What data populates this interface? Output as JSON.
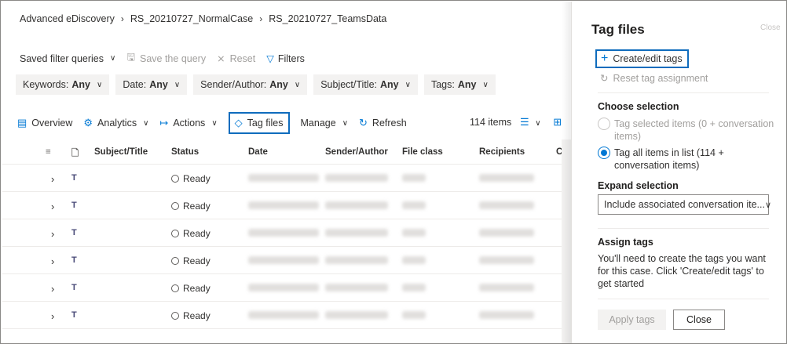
{
  "breadcrumb": [
    "Advanced eDiscovery",
    "RS_20210727_NormalCase",
    "RS_20210727_TeamsData"
  ],
  "toolbar": {
    "saved_queries": "Saved filter queries",
    "save_query": "Save the query",
    "reset": "Reset",
    "filters": "Filters"
  },
  "filters": [
    {
      "label": "Keywords:",
      "value": "Any"
    },
    {
      "label": "Date:",
      "value": "Any"
    },
    {
      "label": "Sender/Author:",
      "value": "Any"
    },
    {
      "label": "Subject/Title:",
      "value": "Any"
    },
    {
      "label": "Tags:",
      "value": "Any"
    }
  ],
  "commands": {
    "overview": "Overview",
    "analytics": "Analytics",
    "actions": "Actions",
    "tag_files": "Tag files",
    "manage": "Manage",
    "refresh": "Refresh"
  },
  "item_count": "114 items",
  "columns": [
    "Subject/Title",
    "Status",
    "Date",
    "Sender/Author",
    "File class",
    "Recipients",
    "C"
  ],
  "rows": [
    {
      "status": "Ready"
    },
    {
      "status": "Ready"
    },
    {
      "status": "Ready"
    },
    {
      "status": "Ready"
    },
    {
      "status": "Ready"
    },
    {
      "status": "Ready"
    }
  ],
  "panel": {
    "title": "Tag files",
    "close_top": "Close",
    "create_edit": "Create/edit tags",
    "reset_assignment": "Reset tag assignment",
    "choose_selection": "Choose selection",
    "option_selected": "Tag selected items (0 + conversation items)",
    "option_all": "Tag all items in list (114 + conversation items)",
    "expand_selection": "Expand selection",
    "expand_value": "Include associated conversation ite...",
    "assign_tags": "Assign tags",
    "assign_text": "You'll need to create the tags you want for this case. Click 'Create/edit tags' to get started",
    "apply": "Apply tags",
    "close": "Close"
  }
}
